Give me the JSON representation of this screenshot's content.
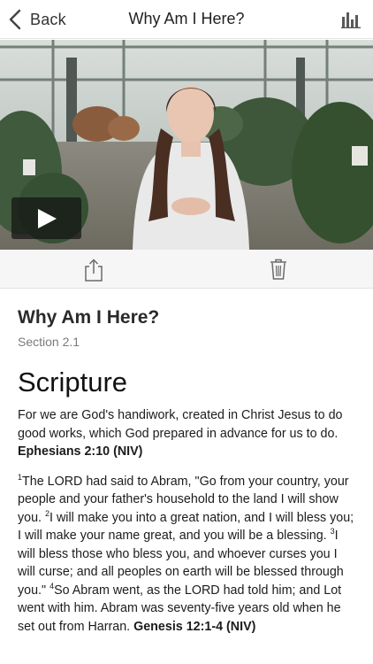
{
  "nav": {
    "back_label": "Back",
    "title": "Why Am I Here?",
    "stats_icon": "bar-chart-icon"
  },
  "video": {
    "play_icon": "play-icon"
  },
  "actions": {
    "share_icon": "share-icon",
    "delete_icon": "trash-icon"
  },
  "lesson": {
    "title": "Why Am I Here?",
    "section": "Section 2.1"
  },
  "scripture": {
    "heading": "Scripture",
    "passage1_text": "For we are God's handiwork, created in Christ Jesus to do good works, which God prepared in advance for us to do.",
    "passage1_ref": "Ephesians 2:10 (NIV)",
    "passage2_verse1_num": "1",
    "passage2_verse1": "The LORD had said to Abram, \"Go from your country, your people and your father's household to the land I will show you. ",
    "passage2_verse2_num": "2",
    "passage2_verse2": "I will make you into a great nation, and I will bless you; I will make your name great, and you will be a blessing. ",
    "passage2_verse3_num": "3",
    "passage2_verse3": "I will bless those who bless you, and whoever curses you I will curse; and all peoples on earth will be blessed through you.\" ",
    "passage2_verse4_num": "4",
    "passage2_verse4": "So Abram went, as the LORD had told him; and Lot went with him. Abram was seventy-five years old when he set out from Harran. ",
    "passage2_ref": "Genesis 12:1-4 (NIV)"
  },
  "colors": {
    "nav_icon": "#555555",
    "action_icon": "#666666",
    "action_bar_bg": "#f6f6f6"
  }
}
